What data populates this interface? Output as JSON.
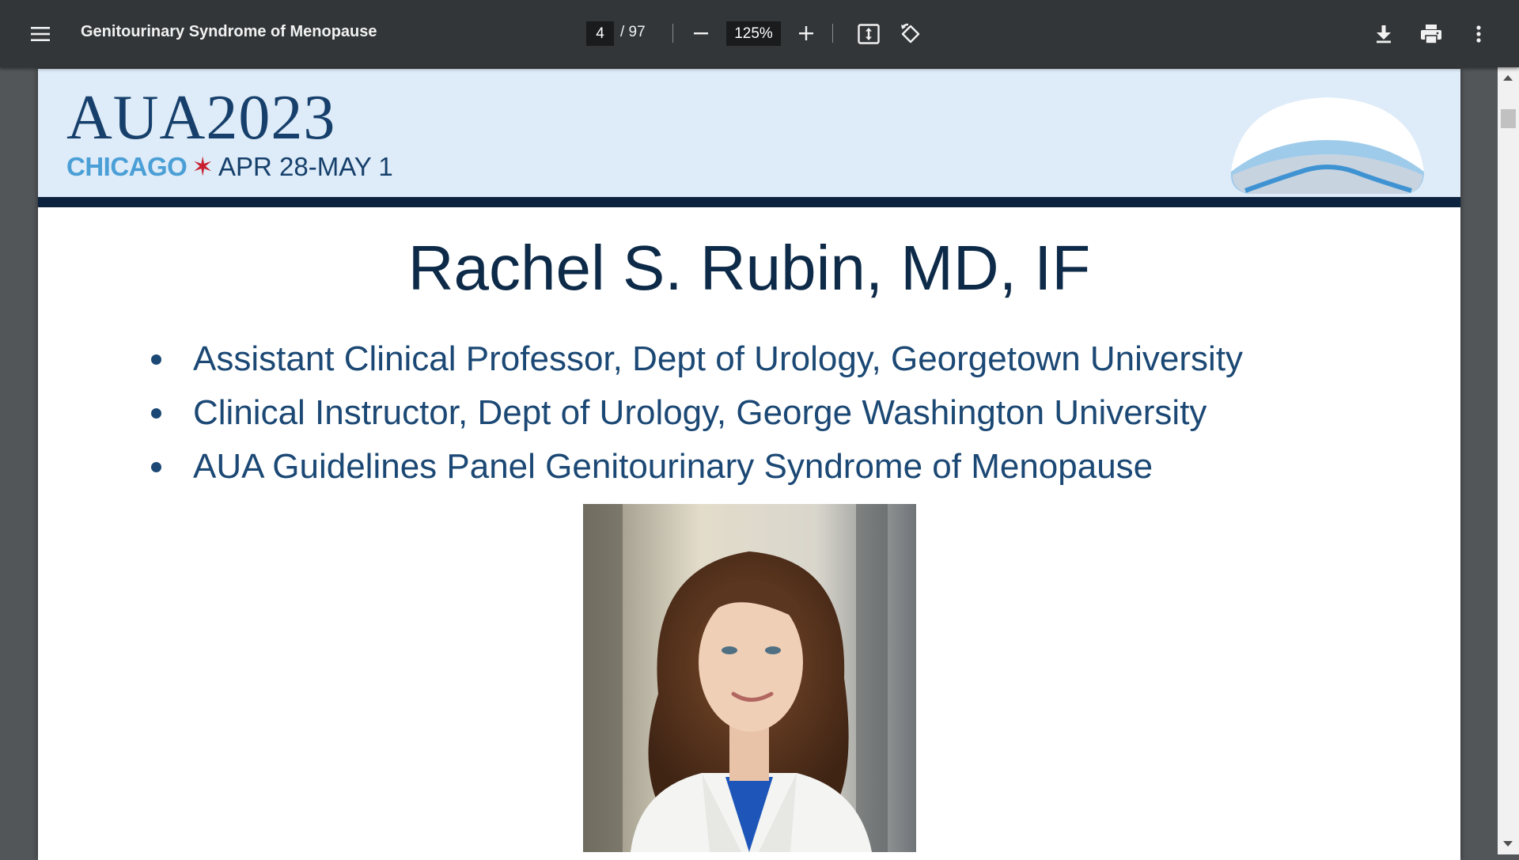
{
  "toolbar": {
    "menu_icon": "hamburger-menu-icon",
    "title": "Genitourinary Syndrome of Menopause",
    "current_page": "4",
    "page_total": "/ 97",
    "zoom_level": "125%",
    "icons": [
      "minus-icon",
      "plus-icon",
      "fit-to-page-icon",
      "rotate-icon",
      "download-icon",
      "print-icon",
      "more-vert-icon"
    ]
  },
  "slide": {
    "banner": {
      "logo_main": "AUA2023",
      "logo_city": "CHICAGO",
      "logo_star": "✶",
      "logo_dates": "APR 28-MAY 1"
    },
    "title": "Rachel S. Rubin, MD, IF",
    "bullets": [
      "Assistant Clinical Professor, Dept of Urology, Georgetown University",
      "Clinical Instructor, Dept of Urology, George Washington University",
      "AUA Guidelines Panel Genitourinary Syndrome of Menopause"
    ]
  },
  "colors": {
    "toolbar_bg": "#323639",
    "viewer_bg": "#525659",
    "banner_bg": "#deebf8",
    "banner_rule": "#0c2340",
    "title_color": "#0d2a48",
    "bullet_color": "#1b4874",
    "logo_accent": "#4a9fd6"
  }
}
